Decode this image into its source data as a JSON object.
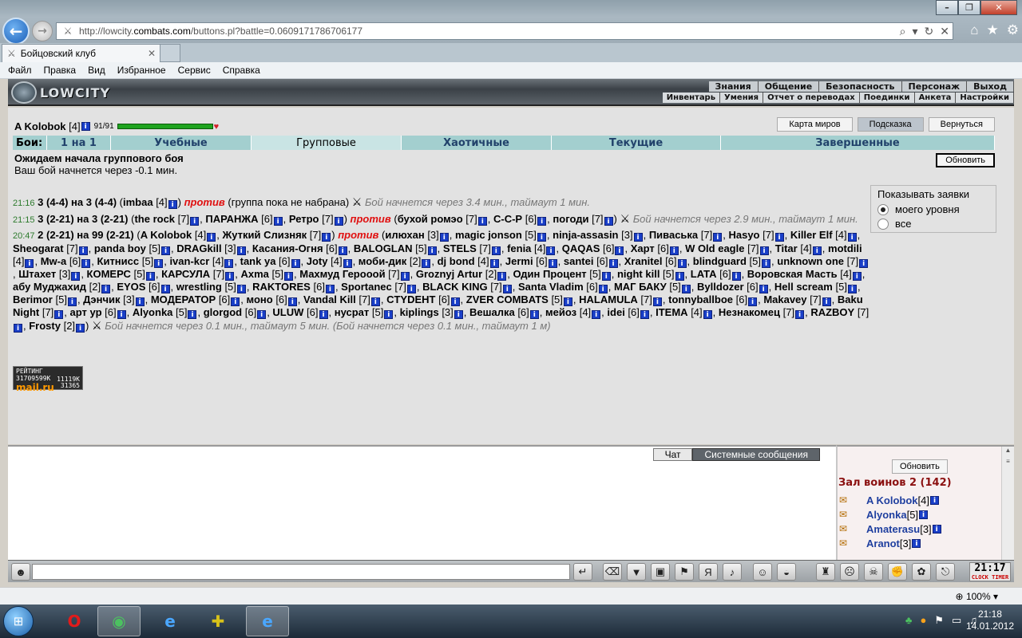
{
  "browser": {
    "url_prefix": "http://lowcity.",
    "url_host": "combats.com",
    "url_rest": "/buttons.pl?battle=0.0609171786706177",
    "tab_title": "Бойцовский клуб",
    "menu": [
      "Файл",
      "Правка",
      "Вид",
      "Избранное",
      "Сервис",
      "Справка"
    ],
    "zoom": "100%"
  },
  "site": {
    "logo": "LOWCITY",
    "top_nav": [
      "Знания",
      "Общение",
      "Безопасность",
      "Персонаж",
      "Выход"
    ],
    "sub_nav": [
      "Инвентарь",
      "Умения",
      "Отчет о переводах",
      "Поединки",
      "Анкета",
      "Настройки"
    ]
  },
  "player": {
    "name": "A Kolobok",
    "level": "[4]",
    "hp": "91/91"
  },
  "top_buttons": [
    "Карта миров",
    "Подсказка",
    "Вернуться"
  ],
  "battle_tabs": {
    "label": "Бои:",
    "items": [
      "1 на 1",
      "Учебные",
      "Групповые",
      "Хаотичные",
      "Текущие",
      "Завершенные"
    ]
  },
  "waiting": {
    "title": "Ожидаем начала группового боя",
    "subtitle": "Ваш бой начнется через -0.1 мин.",
    "refresh": "Обновить"
  },
  "filter": {
    "title": "Показывать заявки",
    "options": [
      "моего уровня",
      "все"
    ],
    "selected": "моего уровня"
  },
  "fights": [
    {
      "time": "21:16",
      "head": "3 (4-4) на 3 (4-4)",
      "team1": [
        "imbaa [4]"
      ],
      "vs": "против",
      "team2_text": "(группа пока не набрана)",
      "note": "Бой начнется через 3.4 мин., таймаут 1 мин."
    },
    {
      "time": "21:15",
      "head": "3 (2-21) на 3 (2-21)",
      "team1": [
        "the rock [7]",
        "ПАРАНЖА [6]",
        "Ретро [7]"
      ],
      "vs": "против",
      "team2": [
        "бухой ромэо [7]",
        "C-C-P [6]",
        "погоди [7]"
      ],
      "note": "Бой начнется через 2.9 мин., таймаут 1 мин."
    },
    {
      "time": "20:47",
      "head": "2 (2-21) на 99 (2-21)",
      "team1": [
        "A Kolobok [4]",
        "Жуткий Слизняк [7]"
      ],
      "vs": "против",
      "team2": [
        "илюхан [3]",
        "magic jonson [5]",
        "ninja-assasin [3]",
        "Пиваська [7]",
        "Hasyo [7]",
        "Killer Elf [4]",
        "Sheogarat [7]",
        "panda boy [5]",
        "DRAGkill [3]",
        "Касания-Огня [6]",
        "BALOGLAN [5]",
        "STELS [7]",
        "fenia [4]",
        "QAQAS [6]",
        "Харт [6]",
        "W Old eagle [7]",
        "Titar [4]",
        "motdili [4]",
        "Mw-a [6]",
        "Китнисс [5]",
        "ivan-kcr [4]",
        "tank ya [6]",
        "Joty [4]",
        "моби-дик [2]",
        "dj bond [4]",
        "Jermi [6]",
        "santei [6]",
        "Xranitel [6]",
        "blindguard [5]",
        "unknown one [7]",
        "Штахет [3]",
        "КОМЕРС [5]",
        "КАРСУЛА [7]",
        "Axma [5]",
        "Махмуд Герооой [7]",
        "Groznyj Artur [2]",
        "Один Процент [5]",
        "night kill [5]",
        "LATA [6]",
        "Воровская Масть [4]",
        "абу Муджахид [2]",
        "EYOS [6]",
        "wrestling [5]",
        "RAKTORES [6]",
        "Sportanec [7]",
        "BLACK KING [7]",
        "Santa Vladim [6]",
        "МАГ БАКУ [5]",
        "Bylldozer [6]",
        "Hell scream [5]",
        "Berimor [5]",
        "Дэнчик [3]",
        "МОДЕРАТОР [6]",
        "моно [6]",
        "Vandal Kill [7]",
        "CTYDEHT [6]",
        "ZVER COMBATS [5]",
        "HALAMULA [7]",
        "tonnyballboe [6]",
        "Makavey [7]",
        "Baku Night [7]",
        "арт ур [6]",
        "Alyonka [5]",
        "glorgod [6]",
        "ULUW [6]",
        "нусрат [5]",
        "kiplings [3]",
        "Вешалка [6]",
        "мейоз [4]",
        "idei [6]",
        "ITEMA [4]",
        "Незнакомец [7]",
        "RAZBOY [7]",
        "Frosty [2]"
      ],
      "note": "Бой начнется через 0.1 мин., таймаут 5 мин. (Бой начнется через 0.1 мин., таймаут 1 м)"
    }
  ],
  "rating": {
    "label": "РЕЙТИНГ",
    "id": "31709599K",
    "brand": "mail.ru",
    "n1": "11119K",
    "n2": "31365"
  },
  "chat": {
    "tabs": [
      "Чат",
      "Системные сообщения"
    ]
  },
  "users": {
    "refresh": "Обновить",
    "room": "Зал воинов 2 (142)",
    "list": [
      {
        "name": "A Kolobok",
        "level": "[4]"
      },
      {
        "name": "Alyonka",
        "level": "[5]"
      },
      {
        "name": "Amaterasu",
        "level": "[3]"
      },
      {
        "name": "Aranot",
        "level": "[3]"
      }
    ]
  },
  "clock": {
    "time": "21:17",
    "sec": "52",
    "label1": "CLOCK",
    "label2": "TIMER"
  },
  "taskbar": {
    "time": "21:18",
    "date": "14.01.2012"
  }
}
